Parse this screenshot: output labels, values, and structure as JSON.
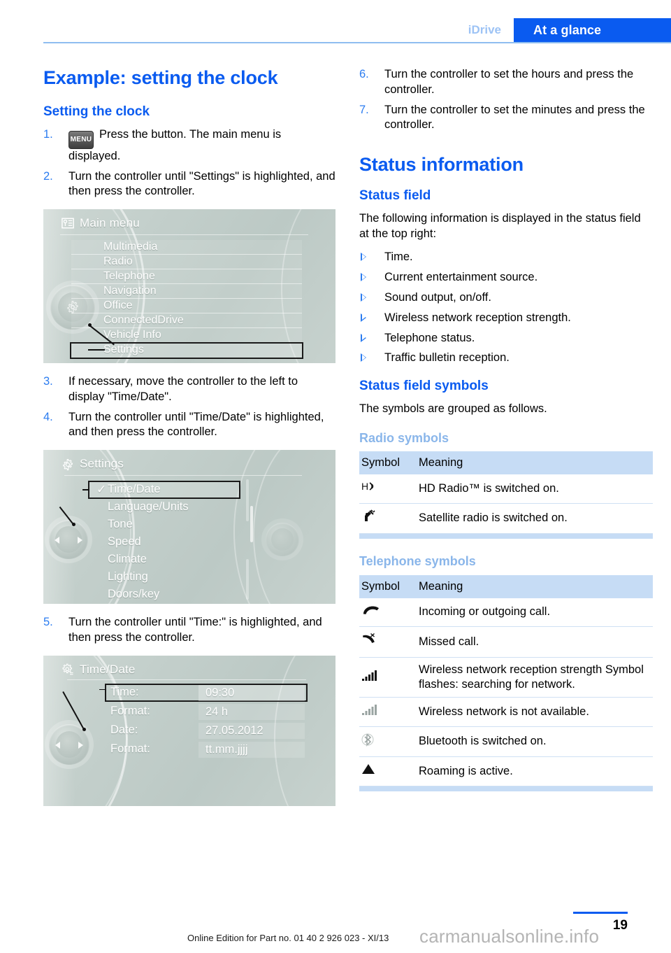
{
  "header": {
    "breadcrumb_secondary": "iDrive",
    "breadcrumb_active": "At a glance",
    "accent_blue": "#0a5bf0",
    "muted_blue": "#9dc3f5"
  },
  "left": {
    "chapter_title": "Example: setting the clock",
    "section_title": "Setting the clock",
    "steps": [
      {
        "num": "1.",
        "icon_label": "MENU",
        "text": "Press the button. The main menu is displayed."
      },
      {
        "num": "2.",
        "text": "Turn the controller until \"Settings\" is highlighted, and then press the controller."
      },
      {
        "num": "3.",
        "text": "If necessary, move the controller to the left to display \"Time/Date\"."
      },
      {
        "num": "4.",
        "text": "Turn the controller until \"Time/Date\" is highlighted, and then press the controller."
      },
      {
        "num": "5.",
        "text": "Turn the controller until \"Time:\" is highlighted, and then press the controller."
      }
    ],
    "screen_main_menu": {
      "title": "Main menu",
      "items": [
        "Multimedia",
        "Radio",
        "Telephone",
        "Navigation",
        "Office",
        "ConnectedDrive",
        "Vehicle Info",
        "Settings"
      ],
      "highlighted": "Settings"
    },
    "screen_settings": {
      "title": "Settings",
      "items": [
        "Time/Date",
        "Language/Units",
        "Tone",
        "Speed",
        "Climate",
        "Lighting",
        "Doors/key"
      ],
      "highlighted": "Time/Date",
      "checkmark": "✓"
    },
    "screen_time_date": {
      "title": "Time/Date",
      "rows": [
        {
          "label": "Time:",
          "value": "09:30",
          "highlighted": true
        },
        {
          "label": "Format:",
          "value": "24 h",
          "highlighted": false
        },
        {
          "label": "Date:",
          "value": "27.05.2012",
          "highlighted": false
        },
        {
          "label": "Format:",
          "value": "tt.mm.jjjj",
          "highlighted": false
        }
      ]
    }
  },
  "right": {
    "steps": [
      {
        "num": "6.",
        "text": "Turn the controller to set the hours and press the controller."
      },
      {
        "num": "7.",
        "text": "Turn the controller to set the minutes and press the controller."
      }
    ],
    "chapter_title": "Status information",
    "status_field_heading": "Status field",
    "status_field_intro": "The following information is displayed in the status field at the top right:",
    "status_field_bullets": [
      "Time.",
      "Current entertainment source.",
      "Sound output, on/off.",
      "Wireless network reception strength.",
      "Telephone status.",
      "Traffic bulletin reception."
    ],
    "symbols_heading": "Status field symbols",
    "symbols_intro": "The symbols are grouped as follows.",
    "radio": {
      "heading": "Radio symbols",
      "columns": [
        "Symbol",
        "Meaning"
      ],
      "rows": [
        {
          "symbol": "hd-radio-icon",
          "symbol_glyph": "Hʟ",
          "meaning": "HD Radio™ is switched on."
        },
        {
          "symbol": "satellite-radio-icon",
          "symbol_glyph": "὎1",
          "meaning": "Satellite radio is switched on."
        }
      ]
    },
    "telephone": {
      "heading": "Telephone symbols",
      "columns": [
        "Symbol",
        "Meaning"
      ],
      "rows": [
        {
          "symbol": "handset-icon",
          "meaning": "Incoming or outgoing call."
        },
        {
          "symbol": "missed-call-icon",
          "meaning": "Missed call."
        },
        {
          "symbol": "signal-bars-icon",
          "meaning": "Wireless network reception strength Symbol flashes: searching for network."
        },
        {
          "symbol": "signal-bars-unavailable-icon",
          "meaning": "Wireless network is not available."
        },
        {
          "symbol": "bluetooth-icon",
          "meaning": "Bluetooth is switched on."
        },
        {
          "symbol": "roaming-icon",
          "meaning": "Roaming is active."
        }
      ]
    }
  },
  "footer": {
    "edition": "Online Edition for Part no. 01 40 2 926 023 - XI/13",
    "page_number": "19",
    "watermark": "carmanualsonline.info"
  }
}
